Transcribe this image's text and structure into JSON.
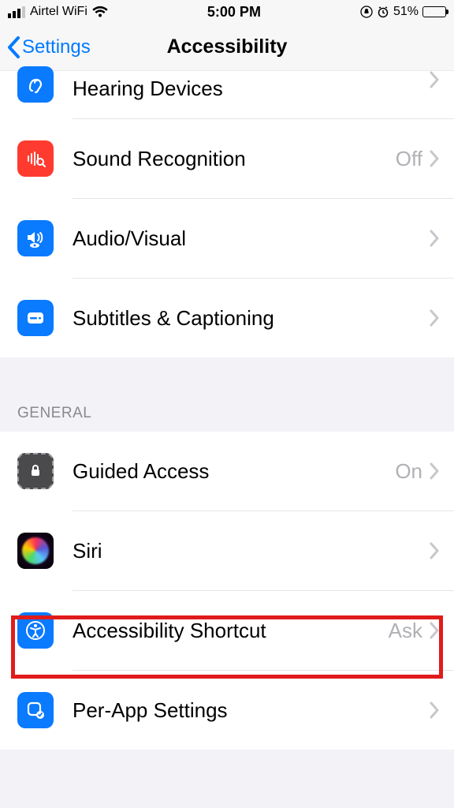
{
  "status": {
    "carrier": "Airtel WiFi",
    "time": "5:00 PM",
    "battery_pct": "51%"
  },
  "nav": {
    "back_label": "Settings",
    "title": "Accessibility"
  },
  "hearing": {
    "hearing_devices": "Hearing Devices",
    "sound_recognition": {
      "label": "Sound Recognition",
      "value": "Off"
    },
    "audio_visual": "Audio/Visual",
    "subtitles": "Subtitles & Captioning"
  },
  "general": {
    "header": "GENERAL",
    "guided_access": {
      "label": "Guided Access",
      "value": "On"
    },
    "siri": "Siri",
    "accessibility_shortcut": {
      "label": "Accessibility Shortcut",
      "value": "Ask"
    },
    "per_app": "Per-App Settings"
  },
  "highlight": {
    "row": "accessibility_shortcut"
  }
}
